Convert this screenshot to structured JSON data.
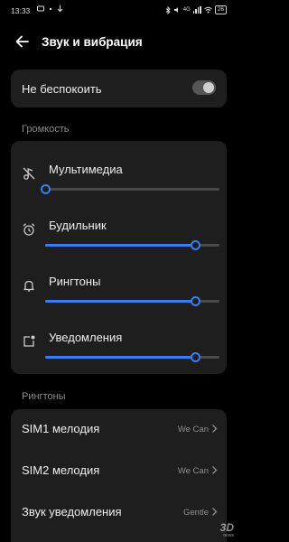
{
  "status_bar": {
    "time": "13:33",
    "battery": "26",
    "network": "4G"
  },
  "header": {
    "title": "Звук и вибрация"
  },
  "do_not_disturb": {
    "label": "Не беспокоить",
    "enabled": false
  },
  "volume": {
    "section_title": "Громкость",
    "items": [
      {
        "label": "Мультимедиа",
        "icon": "muted-music-icon",
        "level": 0.0
      },
      {
        "label": "Будильник",
        "icon": "alarm-clock-icon",
        "level": 0.86
      },
      {
        "label": "Рингтоны",
        "icon": "bell-icon",
        "level": 0.86
      },
      {
        "label": "Уведомления",
        "icon": "notification-icon",
        "level": 0.86
      }
    ],
    "accent_color": "#3b7cf2"
  },
  "ringtones": {
    "section_title": "Рингтоны",
    "items": [
      {
        "label": "SIM1 мелодия",
        "value": "We Can"
      },
      {
        "label": "SIM2 мелодия",
        "value": "We Can"
      },
      {
        "label": "Звук уведомления",
        "value": "Gentle"
      }
    ]
  },
  "watermark": {
    "main": "3D",
    "sub": "news"
  }
}
